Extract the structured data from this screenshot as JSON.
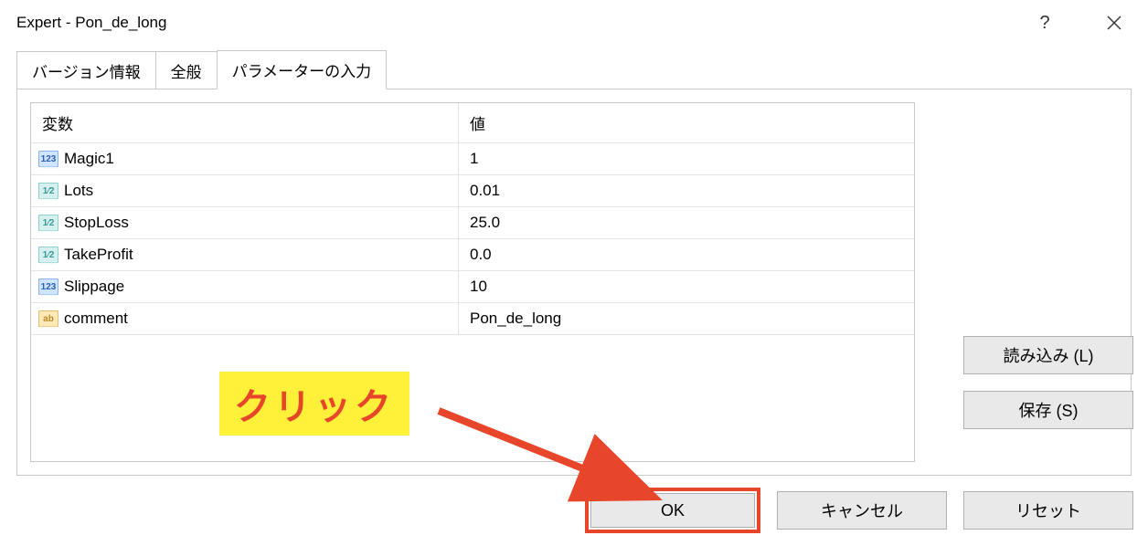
{
  "window": {
    "title": "Expert - Pon_de_long"
  },
  "tabs": {
    "t0": "バージョン情報",
    "t1": "全般",
    "t2": "パラメーターの入力"
  },
  "table": {
    "header_variable": "変数",
    "header_value": "値",
    "rows": [
      {
        "name": "Magic1",
        "value": "1",
        "type": "int"
      },
      {
        "name": "Lots",
        "value": "0.01",
        "type": "float"
      },
      {
        "name": "StopLoss",
        "value": "25.0",
        "type": "float"
      },
      {
        "name": "TakeProfit",
        "value": "0.0",
        "type": "float"
      },
      {
        "name": "Slippage",
        "value": "10",
        "type": "int"
      },
      {
        "name": "comment",
        "value": "Pon_de_long",
        "type": "str"
      }
    ]
  },
  "type_labels": {
    "int": "123",
    "float": "1⁄2",
    "str": "ab"
  },
  "buttons": {
    "load": "読み込み (L)",
    "save": "保存 (S)",
    "ok": "OK",
    "cancel": "キャンセル",
    "reset": "リセット"
  },
  "annotation": {
    "text": "クリック"
  }
}
